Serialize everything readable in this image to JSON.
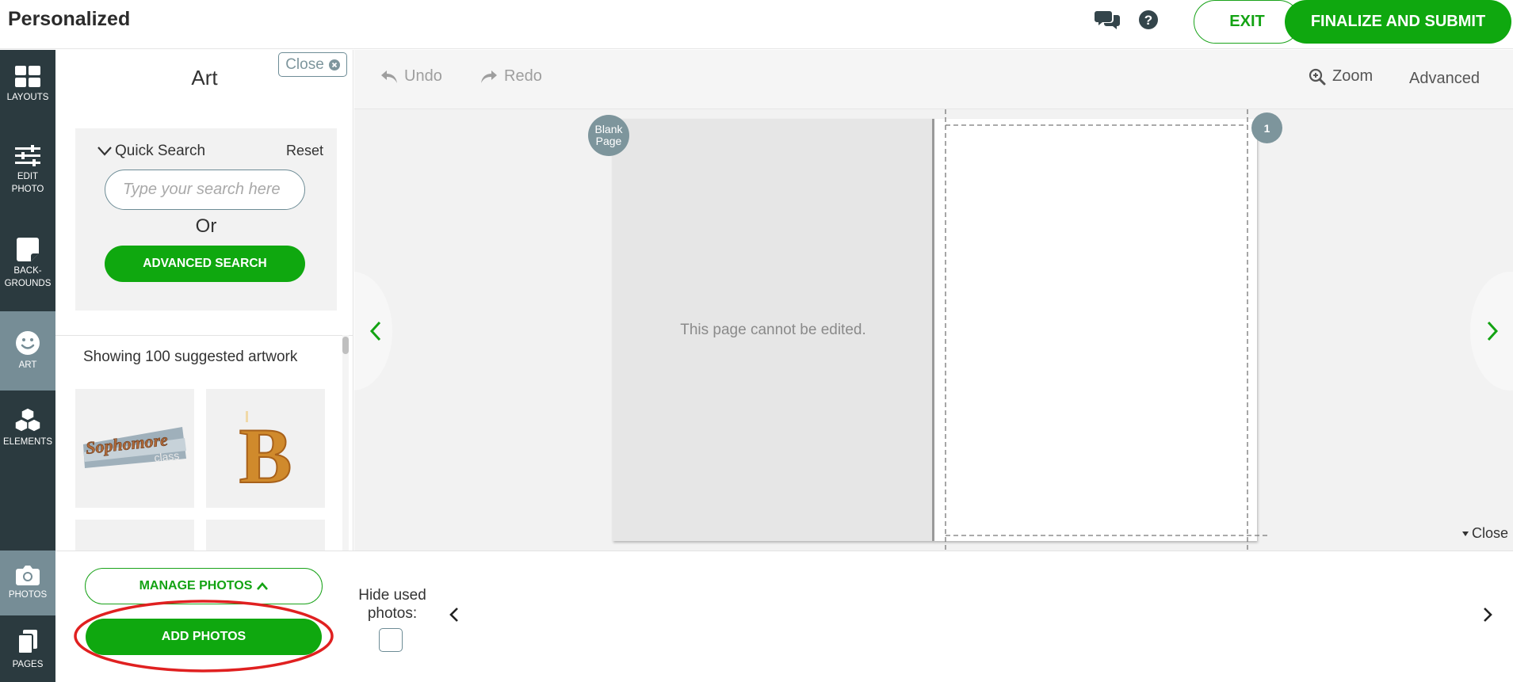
{
  "header": {
    "title": "Personalized",
    "chat_icon": "chat-bubbles-icon",
    "help_icon": "question-circle-icon",
    "exit_label": "EXIT",
    "finalize_label": "FINALIZE AND SUBMIT"
  },
  "rail": {
    "items": [
      {
        "label": "LAYOUTS",
        "icon": "layouts-grid-icon"
      },
      {
        "label": "EDIT PHOTO",
        "icon": "sliders-icon"
      },
      {
        "label": "BACK-GROUNDS",
        "icon": "background-page-icon"
      },
      {
        "label": "ART",
        "icon": "smiley-icon",
        "active": true
      },
      {
        "label": "ELEMENTS",
        "icon": "cubes-icon"
      },
      {
        "label": "PHOTOS",
        "icon": "camera-icon"
      },
      {
        "label": "PAGES",
        "icon": "pages-stack-icon"
      }
    ]
  },
  "panel": {
    "title": "Art",
    "close_label": "Close",
    "quick_search_label": "Quick Search",
    "reset_label": "Reset",
    "search_placeholder": "Type your search here",
    "or_label": "Or",
    "advanced_search_label": "ADVANCED SEARCH",
    "showing_text": "Showing 100 suggested artwork",
    "artwork": [
      {
        "label": "Sophomore",
        "sublabel": "class"
      },
      {
        "label": "B"
      }
    ]
  },
  "editor": {
    "undo_label": "Undo",
    "redo_label": "Redo",
    "zoom_label": "Zoom",
    "advanced_label": "Advanced",
    "blank_page_badge": "Blank Page",
    "page_number_badge": "1",
    "left_page_message": "This page cannot be edited.",
    "close_label": "Close"
  },
  "tray": {
    "manage_photos_label": "MANAGE PHOTOS",
    "add_photos_label": "ADD PHOTOS",
    "hide_used_label": "Hide used photos:",
    "hide_used_checked": false
  },
  "colors": {
    "brand_green": "#0fa80f",
    "rail_bg": "#2b3a3f",
    "rail_active": "#768d96",
    "badge_gray": "#7d959c",
    "highlight_red": "#e02020"
  }
}
